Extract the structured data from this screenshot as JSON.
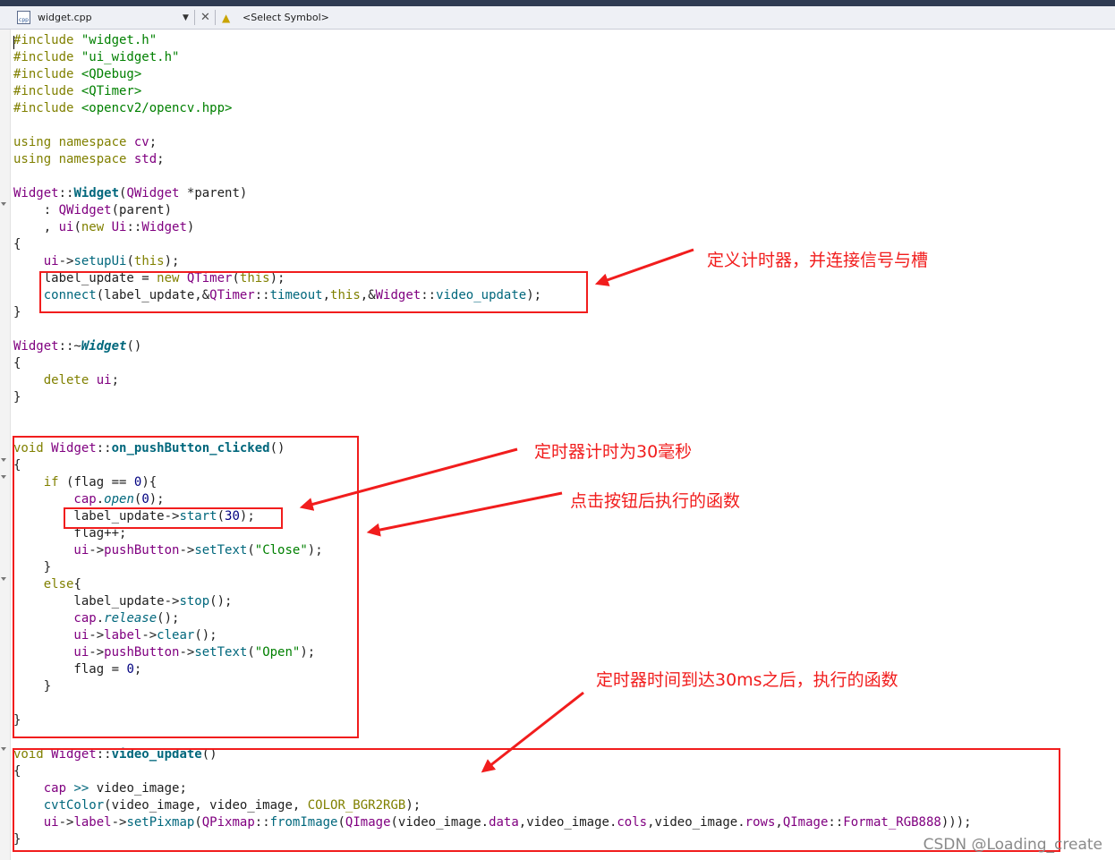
{
  "toolbar": {
    "file_name": "widget.cpp",
    "file_icon_text": "cpp",
    "symbol_selector": "<Select Symbol>"
  },
  "code_lines": [
    [
      {
        "t": "#include ",
        "c": "k"
      },
      {
        "t": "\"widget.h\"",
        "c": "s"
      }
    ],
    [
      {
        "t": "#include ",
        "c": "k"
      },
      {
        "t": "\"ui_widget.h\"",
        "c": "s"
      }
    ],
    [
      {
        "t": "#include ",
        "c": "k"
      },
      {
        "t": "<QDebug>",
        "c": "s"
      }
    ],
    [
      {
        "t": "#include ",
        "c": "k"
      },
      {
        "t": "<QTimer>",
        "c": "s"
      }
    ],
    [
      {
        "t": "#include ",
        "c": "k"
      },
      {
        "t": "<opencv2/opencv.hpp>",
        "c": "s"
      }
    ],
    [],
    [
      {
        "t": "using namespace ",
        "c": "k"
      },
      {
        "t": "cv",
        "c": "t"
      },
      {
        "t": ";",
        "c": ""
      }
    ],
    [
      {
        "t": "using namespace ",
        "c": "k"
      },
      {
        "t": "std",
        "c": "t"
      },
      {
        "t": ";",
        "c": ""
      }
    ],
    [],
    [
      {
        "t": "Widget",
        "c": "t"
      },
      {
        "t": "::",
        "c": ""
      },
      {
        "t": "Widget",
        "c": "fb"
      },
      {
        "t": "(",
        "c": ""
      },
      {
        "t": "QWidget",
        "c": "t"
      },
      {
        "t": " *parent)",
        "c": ""
      }
    ],
    [
      {
        "t": "    : ",
        "c": ""
      },
      {
        "t": "QWidget",
        "c": "t"
      },
      {
        "t": "(parent)",
        "c": ""
      }
    ],
    [
      {
        "t": "    , ",
        "c": ""
      },
      {
        "t": "ui",
        "c": "t"
      },
      {
        "t": "(",
        "c": ""
      },
      {
        "t": "new ",
        "c": "k"
      },
      {
        "t": "Ui",
        "c": "t"
      },
      {
        "t": "::",
        "c": ""
      },
      {
        "t": "Widget",
        "c": "t"
      },
      {
        "t": ")",
        "c": ""
      }
    ],
    [
      {
        "t": "{",
        "c": ""
      }
    ],
    [
      {
        "t": "    ui",
        "c": "t"
      },
      {
        "t": "->",
        "c": ""
      },
      {
        "t": "setupUi",
        "c": "f"
      },
      {
        "t": "(",
        "c": ""
      },
      {
        "t": "this",
        "c": "k"
      },
      {
        "t": ");",
        "c": ""
      }
    ],
    [
      {
        "t": "    label_update",
        "c": ""
      },
      {
        "t": " = ",
        "c": ""
      },
      {
        "t": "new ",
        "c": "k"
      },
      {
        "t": "QTimer",
        "c": "t"
      },
      {
        "t": "(",
        "c": ""
      },
      {
        "t": "this",
        "c": "k"
      },
      {
        "t": ");",
        "c": ""
      }
    ],
    [
      {
        "t": "    connect",
        "c": "f"
      },
      {
        "t": "(label_update,&",
        "c": ""
      },
      {
        "t": "QTimer",
        "c": "t"
      },
      {
        "t": "::",
        "c": ""
      },
      {
        "t": "timeout",
        "c": "f"
      },
      {
        "t": ",",
        "c": ""
      },
      {
        "t": "this",
        "c": "k"
      },
      {
        "t": ",&",
        "c": ""
      },
      {
        "t": "Widget",
        "c": "t"
      },
      {
        "t": "::",
        "c": ""
      },
      {
        "t": "video_update",
        "c": "f"
      },
      {
        "t": ");",
        "c": ""
      }
    ],
    [
      {
        "t": "}",
        "c": ""
      }
    ],
    [],
    [
      {
        "t": "Widget",
        "c": "t"
      },
      {
        "t": "::~",
        "c": ""
      },
      {
        "t": "Widget",
        "c": "iti"
      },
      {
        "t": "()",
        "c": ""
      }
    ],
    [
      {
        "t": "{",
        "c": ""
      }
    ],
    [
      {
        "t": "    delete ",
        "c": "k"
      },
      {
        "t": "ui",
        "c": "t"
      },
      {
        "t": ";",
        "c": ""
      }
    ],
    [
      {
        "t": "}",
        "c": ""
      }
    ],
    [],
    [],
    [
      {
        "t": "void ",
        "c": "k"
      },
      {
        "t": "Widget",
        "c": "t"
      },
      {
        "t": "::",
        "c": ""
      },
      {
        "t": "on_pushButton_clicked",
        "c": "fb"
      },
      {
        "t": "()",
        "c": ""
      }
    ],
    [
      {
        "t": "{",
        "c": ""
      }
    ],
    [
      {
        "t": "    if ",
        "c": "k"
      },
      {
        "t": "(flag == ",
        "c": ""
      },
      {
        "t": "0",
        "c": "n"
      },
      {
        "t": "){",
        "c": ""
      }
    ],
    [
      {
        "t": "        cap",
        "c": "t"
      },
      {
        "t": ".",
        "c": ""
      },
      {
        "t": "open",
        "c": "it"
      },
      {
        "t": "(",
        "c": ""
      },
      {
        "t": "0",
        "c": "n"
      },
      {
        "t": ");",
        "c": ""
      }
    ],
    [
      {
        "t": "        label_update",
        "c": ""
      },
      {
        "t": "->",
        "c": ""
      },
      {
        "t": "start",
        "c": "f"
      },
      {
        "t": "(",
        "c": ""
      },
      {
        "t": "30",
        "c": "n"
      },
      {
        "t": ");",
        "c": ""
      }
    ],
    [
      {
        "t": "        flag++;",
        "c": ""
      }
    ],
    [
      {
        "t": "        ui",
        "c": "t"
      },
      {
        "t": "->",
        "c": ""
      },
      {
        "t": "pushButton",
        "c": "t"
      },
      {
        "t": "->",
        "c": ""
      },
      {
        "t": "setText",
        "c": "f"
      },
      {
        "t": "(",
        "c": ""
      },
      {
        "t": "\"Close\"",
        "c": "s"
      },
      {
        "t": ");",
        "c": ""
      }
    ],
    [
      {
        "t": "    }",
        "c": ""
      }
    ],
    [
      {
        "t": "    else",
        "c": "k"
      },
      {
        "t": "{",
        "c": ""
      }
    ],
    [
      {
        "t": "        label_update",
        "c": ""
      },
      {
        "t": "->",
        "c": ""
      },
      {
        "t": "stop",
        "c": "f"
      },
      {
        "t": "();",
        "c": ""
      }
    ],
    [
      {
        "t": "        cap",
        "c": "t"
      },
      {
        "t": ".",
        "c": ""
      },
      {
        "t": "release",
        "c": "it"
      },
      {
        "t": "();",
        "c": ""
      }
    ],
    [
      {
        "t": "        ui",
        "c": "t"
      },
      {
        "t": "->",
        "c": ""
      },
      {
        "t": "label",
        "c": "t"
      },
      {
        "t": "->",
        "c": ""
      },
      {
        "t": "clear",
        "c": "f"
      },
      {
        "t": "();",
        "c": ""
      }
    ],
    [
      {
        "t": "        ui",
        "c": "t"
      },
      {
        "t": "->",
        "c": ""
      },
      {
        "t": "pushButton",
        "c": "t"
      },
      {
        "t": "->",
        "c": ""
      },
      {
        "t": "setText",
        "c": "f"
      },
      {
        "t": "(",
        "c": ""
      },
      {
        "t": "\"Open\"",
        "c": "s"
      },
      {
        "t": ");",
        "c": ""
      }
    ],
    [
      {
        "t": "        flag = ",
        "c": ""
      },
      {
        "t": "0",
        "c": "n"
      },
      {
        "t": ";",
        "c": ""
      }
    ],
    [
      {
        "t": "    }",
        "c": ""
      }
    ],
    [],
    [
      {
        "t": "}",
        "c": ""
      }
    ],
    [],
    [
      {
        "t": "void ",
        "c": "k"
      },
      {
        "t": "Widget",
        "c": "t"
      },
      {
        "t": "::",
        "c": ""
      },
      {
        "t": "video_update",
        "c": "fb"
      },
      {
        "t": "()",
        "c": ""
      }
    ],
    [
      {
        "t": "{",
        "c": ""
      }
    ],
    [
      {
        "t": "    cap ",
        "c": "t"
      },
      {
        "t": ">>",
        "c": "f"
      },
      {
        "t": " video_image;",
        "c": ""
      }
    ],
    [
      {
        "t": "    cvtColor",
        "c": "f"
      },
      {
        "t": "(video_image, video_image, ",
        "c": ""
      },
      {
        "t": "COLOR_BGR2RGB",
        "c": "k"
      },
      {
        "t": ");",
        "c": ""
      }
    ],
    [
      {
        "t": "    ui",
        "c": "t"
      },
      {
        "t": "->",
        "c": ""
      },
      {
        "t": "label",
        "c": "t"
      },
      {
        "t": "->",
        "c": ""
      },
      {
        "t": "setPixmap",
        "c": "f"
      },
      {
        "t": "(",
        "c": ""
      },
      {
        "t": "QPixmap",
        "c": "t"
      },
      {
        "t": "::",
        "c": ""
      },
      {
        "t": "fromImage",
        "c": "f"
      },
      {
        "t": "(",
        "c": ""
      },
      {
        "t": "QImage",
        "c": "t"
      },
      {
        "t": "(video_image.",
        "c": ""
      },
      {
        "t": "data",
        "c": "t"
      },
      {
        "t": ",video_image.",
        "c": ""
      },
      {
        "t": "cols",
        "c": "t"
      },
      {
        "t": ",video_image.",
        "c": ""
      },
      {
        "t": "rows",
        "c": "t"
      },
      {
        "t": ",",
        "c": ""
      },
      {
        "t": "QImage",
        "c": "t"
      },
      {
        "t": "::",
        "c": ""
      },
      {
        "t": "Format_RGB888",
        "c": "t"
      },
      {
        "t": ")));",
        "c": ""
      }
    ],
    [
      {
        "t": "}",
        "c": ""
      }
    ]
  ],
  "annotations": {
    "timer_define": "定义计时器，并连接信号与槽",
    "timer_30ms": "定时器计时为30毫秒",
    "button_func": "点击按钮后执行的函数",
    "timeout_func": "定时器时间到达30ms之后，执行的函数"
  },
  "watermark": "CSDN @Loading_create",
  "colors": {
    "annotation_red": "#f11d1d",
    "keyword": "#808000",
    "string": "#008000",
    "type": "#800080",
    "function": "#00677c",
    "number": "#000080"
  }
}
